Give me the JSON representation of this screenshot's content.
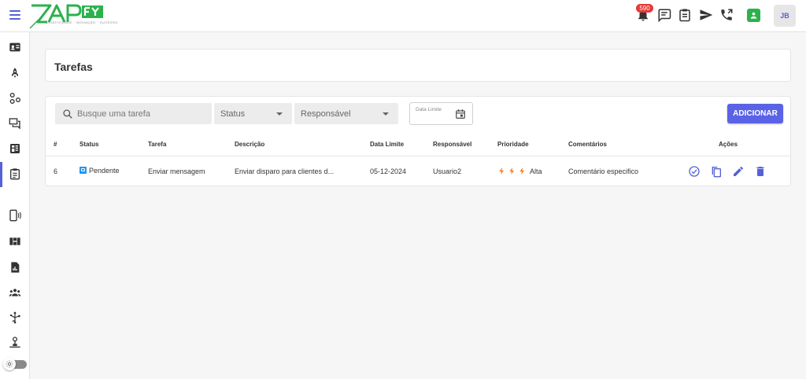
{
  "app": {
    "name": "ZAPFY",
    "tagline": "CRIATIVIDADE · INOVAÇÃO · SUCESSO"
  },
  "colors": {
    "accent": "#5561d6",
    "brand_green": "#2bb24c",
    "danger": "#e53935",
    "priority": "#ff7a1a"
  },
  "topbar": {
    "notifications_count": "590",
    "icons": [
      "bell-icon",
      "chat-icon",
      "clipboard-icon",
      "send-icon",
      "phone-icon",
      "whatsapp-contact-icon"
    ],
    "user_initials": "JB"
  },
  "sidebar": {
    "items": [
      {
        "icon": "contact-card-icon"
      },
      {
        "icon": "rocket-icon"
      },
      {
        "icon": "flow-icon"
      },
      {
        "icon": "forum-icon"
      },
      {
        "icon": "dashboard-icon"
      },
      {
        "icon": "tasks-icon",
        "active": true
      },
      {
        "icon": "device-icon"
      },
      {
        "icon": "board-icon"
      },
      {
        "icon": "report-icon"
      },
      {
        "icon": "users-icon"
      },
      {
        "icon": "integrations-icon"
      },
      {
        "icon": "network-icon"
      }
    ]
  },
  "page": {
    "title": "Tarefas"
  },
  "filters": {
    "search_placeholder": "Busque uma tarefa",
    "status_label": "Status",
    "responsavel_label": "Responsável",
    "date_label": "Data Limite",
    "add_button": "ADICIONAR"
  },
  "table": {
    "headers": {
      "id": "#",
      "status": "Status",
      "tarefa": "Tarefa",
      "descricao": "Descrição",
      "data_limite": "Data Limite",
      "responsavel": "Responsável",
      "prioridade": "Prioridade",
      "comentarios": "Comentários",
      "acoes": "Ações"
    },
    "rows": [
      {
        "id": "6",
        "status": "Pendente",
        "tarefa": "Enviar mensagem",
        "descricao": "Enviar disparo para clientes d...",
        "data_limite": "05-12-2024",
        "responsavel": "Usuario2",
        "prioridade": "Alta",
        "prioridade_level": 3,
        "comentarios": "Comentário especifico",
        "actions": [
          "complete-icon",
          "copy-icon",
          "edit-icon",
          "delete-icon"
        ]
      }
    ]
  }
}
